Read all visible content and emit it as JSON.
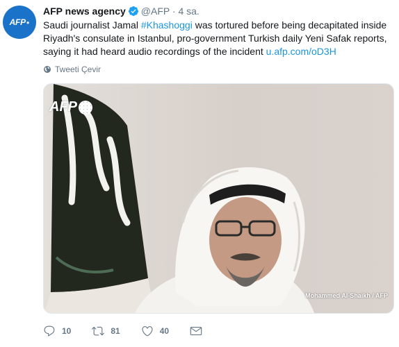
{
  "avatar": {
    "logo_text": "AFP"
  },
  "author": {
    "name": "AFP news agency",
    "handle": "@AFP",
    "separator": "·",
    "time": "4 sa."
  },
  "tweet": {
    "text_part1": "Saudi journalist Jamal ",
    "hashtag": "#Khashoggi",
    "text_part2": " was tortured before being decapitated inside Riyadh's consulate in Istanbul, pro-government Turkish daily Yeni Safak reports, saying it had heard audio recordings of the incident ",
    "link": "u.afp.com/oD3H"
  },
  "translate": {
    "label": "Tweeti Çevir"
  },
  "media": {
    "watermark": "AFP",
    "credit": "Mohammed Al-Shaikh / AFP"
  },
  "actions": {
    "replies": "10",
    "retweets": "81",
    "likes": "40"
  },
  "colors": {
    "link": "#1b95e0",
    "muted": "#657786",
    "verified": "#1da1f2",
    "afp_blue": "#1a73c9"
  }
}
